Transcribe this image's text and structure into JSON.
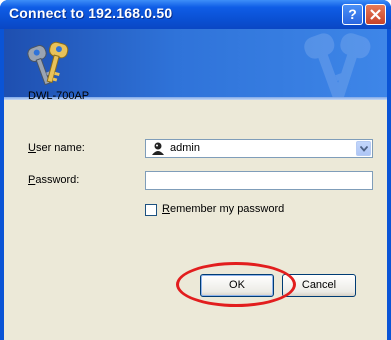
{
  "window": {
    "title": "Connect to 192.168.0.50"
  },
  "titlebar": {
    "help_icon": "question-mark-icon",
    "close_icon": "close-icon"
  },
  "banner": {
    "icon": "keys-icon"
  },
  "form": {
    "device_name": "DWL-700AP",
    "username_label": "User name:",
    "username_value": "admin",
    "password_label": "Password:",
    "password_value": "",
    "remember_label": "Remember my password",
    "remember_checked": false
  },
  "buttons": {
    "ok": "OK",
    "cancel": "Cancel"
  },
  "annotation": {
    "ring_color": "#e21e1e"
  }
}
